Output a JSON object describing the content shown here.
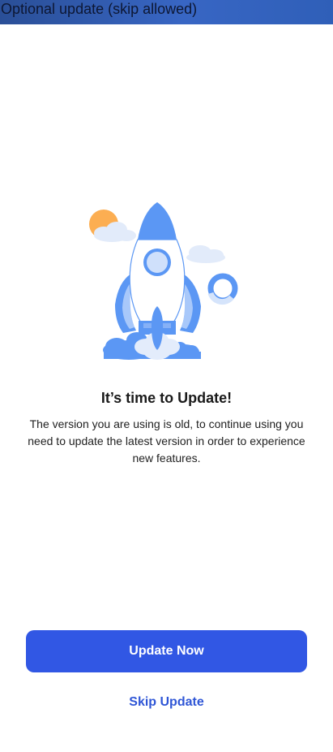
{
  "header": {
    "label": "Optional update (skip allowed)"
  },
  "illustration": {
    "icon": "rocket-launch-illustration",
    "colors": {
      "primary_blue": "#5b97f4",
      "light_blue": "#d5e4fb",
      "sun_orange": "#fcae52",
      "cloud": "#e3ecfb"
    }
  },
  "content": {
    "title": "It’s time to Update!",
    "description": "The version you are using is old, to continue using you need to update the latest version in order to experience new features."
  },
  "actions": {
    "update_label": "Update Now",
    "skip_label": "Skip Update"
  },
  "colors": {
    "accent": "#3157e4",
    "link": "#2f56d6",
    "banner": "#3866c4"
  }
}
